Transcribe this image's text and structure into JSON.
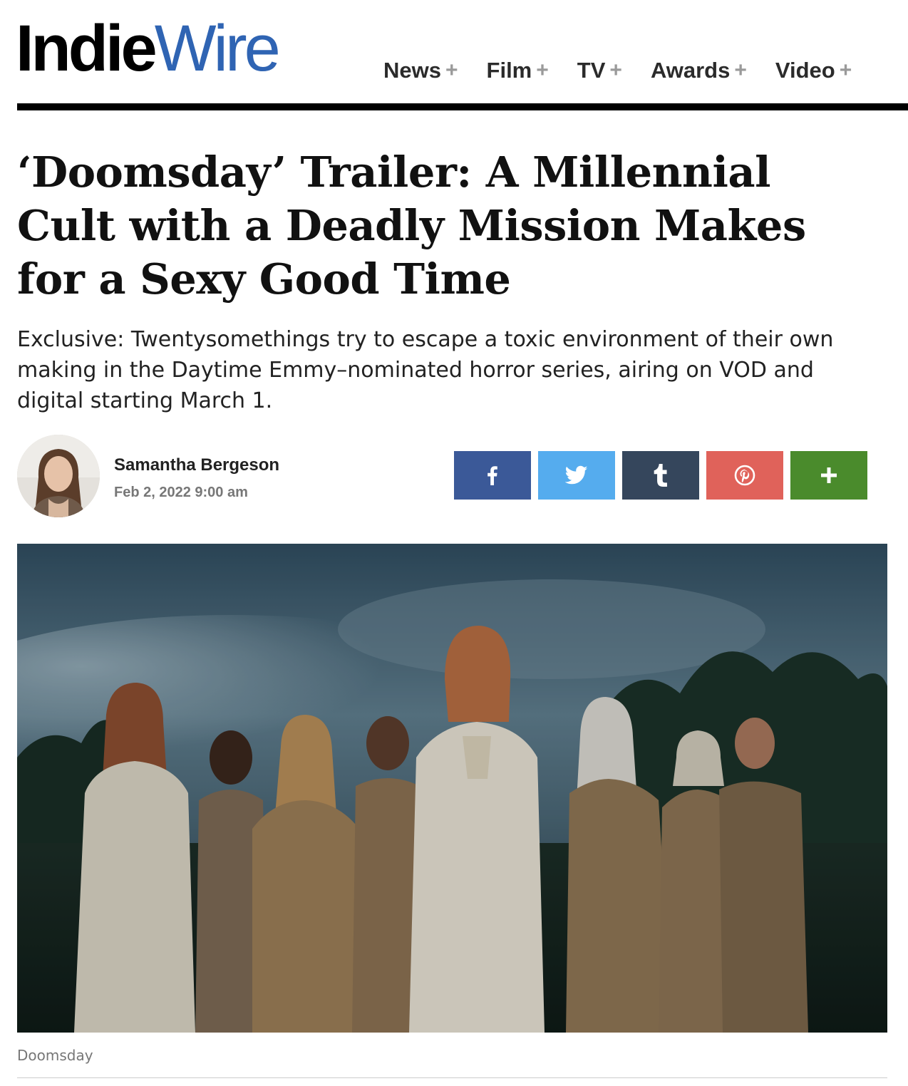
{
  "logo": {
    "part1": "Indie",
    "part2": "Wire"
  },
  "nav": [
    {
      "label": "News",
      "plus": "+"
    },
    {
      "label": "Film",
      "plus": "+"
    },
    {
      "label": "TV",
      "plus": "+"
    },
    {
      "label": "Awards",
      "plus": "+"
    },
    {
      "label": "Video",
      "plus": "+"
    }
  ],
  "article": {
    "title": "‘Doomsday’ Trailer: A Millennial Cult with a Deadly Mission Makes for a Sexy Good Time",
    "dek": "Exclusive: Twentysomethings try to escape a toxic environment of their own making in the Daytime Emmy–nominated horror series, airing on VOD and digital starting March 1.",
    "author": "Samantha Bergeson",
    "date": "Feb 2, 2022 9:00 am",
    "image_caption": "Doomsday"
  },
  "share": [
    {
      "icon": "facebook-icon",
      "color": "#3b5998",
      "glyph": "f"
    },
    {
      "icon": "twitter-icon",
      "color": "#55acee",
      "glyph": ""
    },
    {
      "icon": "tumblr-icon",
      "color": "#35465c",
      "glyph": "t"
    },
    {
      "icon": "pinterest-icon",
      "color": "#e0625a",
      "glyph": ""
    },
    {
      "icon": "more-share-icon",
      "color": "#4a8b2c",
      "glyph": "+"
    }
  ]
}
